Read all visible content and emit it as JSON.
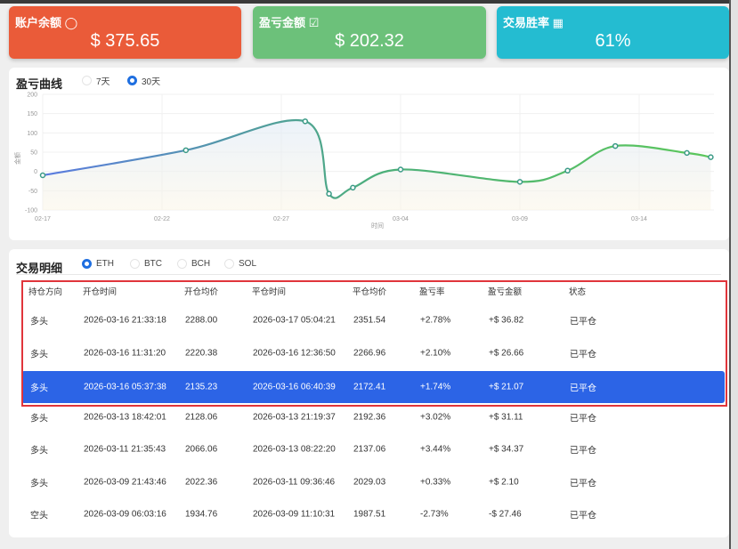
{
  "cards": [
    {
      "title": "账户余额",
      "icon": "money-bag-icon",
      "value": "$  375.65",
      "color": "#ea5b39"
    },
    {
      "title": "盈亏金额",
      "icon": "check-square-icon",
      "value": "$  202.32",
      "color": "#6cc17a"
    },
    {
      "title": "交易胜率",
      "icon": "bar-chart-icon",
      "value": "61%",
      "color": "#24bcd1"
    }
  ],
  "pnl": {
    "title": "盈亏曲线",
    "ranges": [
      {
        "label": "7天",
        "selected": false
      },
      {
        "label": "30天",
        "selected": true
      }
    ]
  },
  "chart_data": {
    "type": "line",
    "title": "盈亏曲线",
    "xlabel": "时间",
    "ylabel": "金额",
    "ylim": [
      -100,
      200
    ],
    "yticks": [
      200,
      150,
      100,
      50,
      0,
      -50,
      -100
    ],
    "xticks": [
      "02-17",
      "02-22",
      "02-27",
      "03-04",
      "03-09",
      "03-14"
    ],
    "points": [
      {
        "date": "02-17",
        "y": -10
      },
      {
        "date": "02-23",
        "y": 55
      },
      {
        "date": "02-28",
        "y": 130
      },
      {
        "date": "03-01",
        "y": -58
      },
      {
        "date": "03-02",
        "y": -42
      },
      {
        "date": "03-04",
        "y": 5
      },
      {
        "date": "03-09",
        "y": -27
      },
      {
        "date": "03-11",
        "y": 2
      },
      {
        "date": "03-13",
        "y": 66
      },
      {
        "date": "03-16",
        "y": 48
      },
      {
        "date": "03-17",
        "y": 37
      }
    ],
    "colors": [
      "#5b7be0",
      "#4caf7a",
      "#5cc75c"
    ]
  },
  "trades": {
    "title": "交易明细",
    "symbols": [
      {
        "label": "ETH",
        "selected": true
      },
      {
        "label": "BTC",
        "selected": false
      },
      {
        "label": "BCH",
        "selected": false
      },
      {
        "label": "SOL",
        "selected": false
      }
    ],
    "columns": [
      "持仓方向",
      "开仓时间",
      "开仓均价",
      "平仓时间",
      "平仓均价",
      "盈亏率",
      "盈亏金额",
      "状态"
    ],
    "rows": [
      [
        "多头",
        "2026-03-16 21:33:18",
        "2288.00",
        "2026-03-17 05:04:21",
        "2351.54",
        "+2.78%",
        "+$ 36.82",
        "已平仓"
      ],
      [
        "多头",
        "2026-03-16 11:31:20",
        "2220.38",
        "2026-03-16 12:36:50",
        "2266.96",
        "+2.10%",
        "+$ 26.66",
        "已平仓"
      ],
      [
        "多头",
        "2026-03-16 05:37:38",
        "2135.23",
        "2026-03-16 06:40:39",
        "2172.41",
        "+1.74%",
        "+$ 21.07",
        "已平仓"
      ],
      [
        "多头",
        "2026-03-13 18:42:01",
        "2128.06",
        "2026-03-13 21:19:37",
        "2192.36",
        "+3.02%",
        "+$ 31.11",
        "已平仓"
      ],
      [
        "多头",
        "2026-03-11 21:35:43",
        "2066.06",
        "2026-03-13 08:22:20",
        "2137.06",
        "+3.44%",
        "+$ 34.37",
        "已平仓"
      ],
      [
        "多头",
        "2026-03-09 21:43:46",
        "2022.36",
        "2026-03-11 09:36:46",
        "2029.03",
        "+0.33%",
        "+$ 2.10",
        "已平仓"
      ],
      [
        "空头",
        "2026-03-09 06:03:16",
        "1934.76",
        "2026-03-09 11:10:31",
        "1987.51",
        "-2.73%",
        "-$ 27.46",
        "已平仓"
      ]
    ],
    "selected_row": 2
  }
}
